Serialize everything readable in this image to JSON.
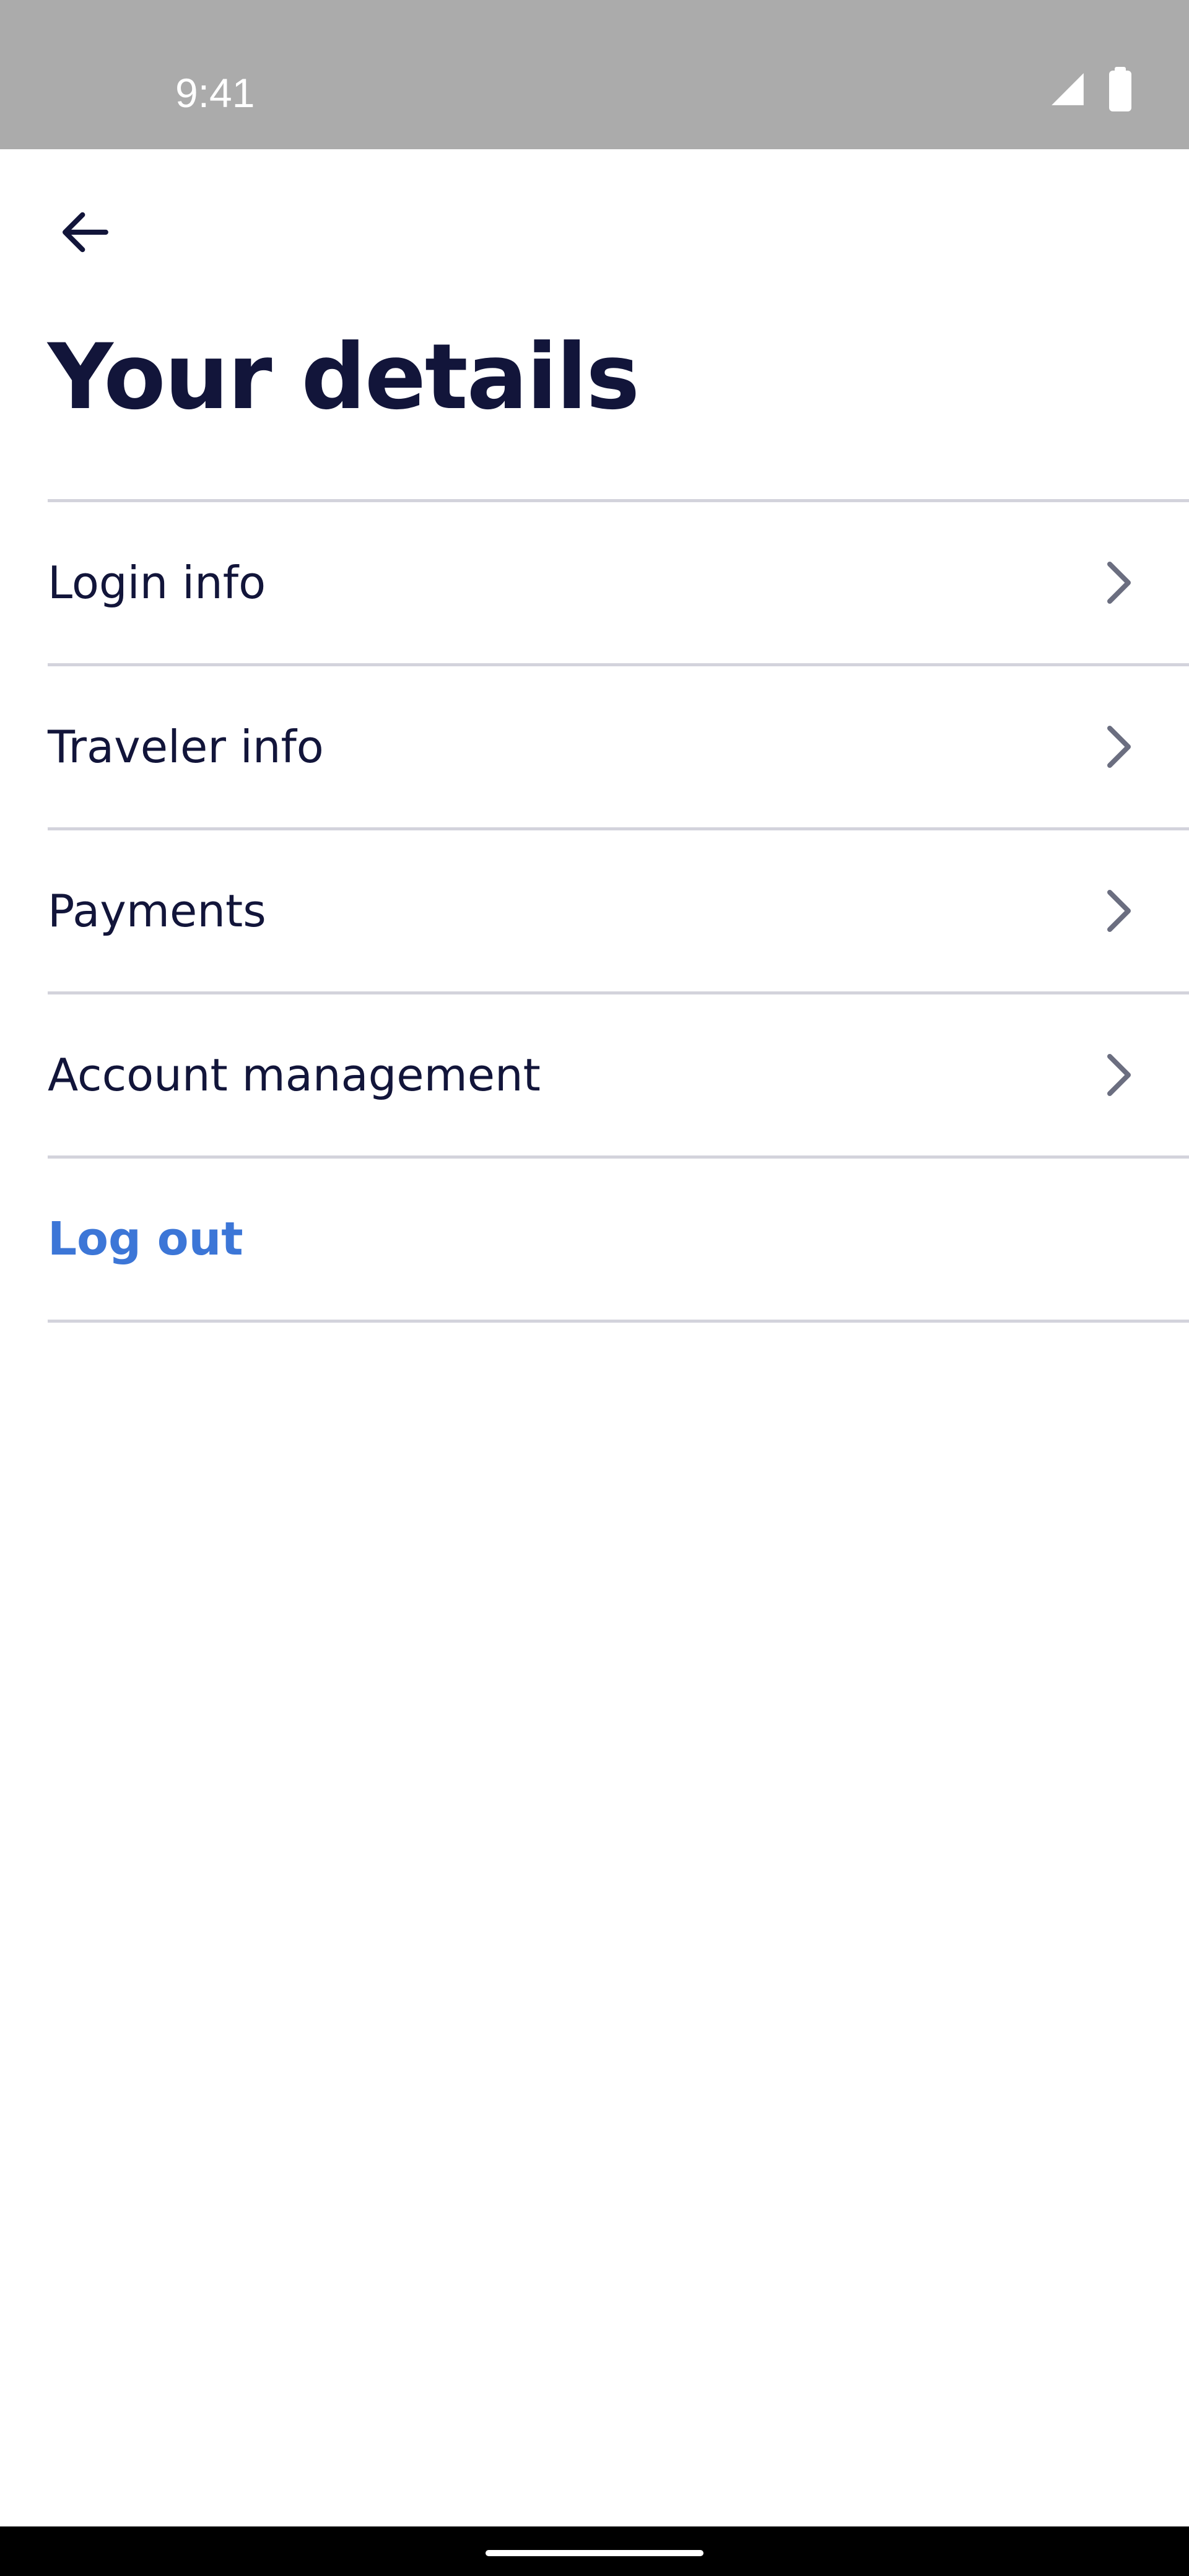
{
  "status_bar": {
    "time": "9:41",
    "icons": [
      "cellular-signal-icon",
      "battery-icon"
    ]
  },
  "header": {
    "back_icon": "arrow-left-icon",
    "title": "Your details"
  },
  "menu": {
    "items": [
      {
        "label": "Login info",
        "icon": "chevron-right-icon"
      },
      {
        "label": "Traveler info",
        "icon": "chevron-right-icon"
      },
      {
        "label": "Payments",
        "icon": "chevron-right-icon"
      },
      {
        "label": "Account management",
        "icon": "chevron-right-icon"
      }
    ],
    "logout_label": "Log out"
  },
  "colors": {
    "status_bar_bg": "#ababab",
    "title_text": "#12153a",
    "divider": "#d3d3dc",
    "link_accent": "#3c76d7",
    "chevron": "#6b6e80",
    "nav_bar_bg": "#000000"
  }
}
